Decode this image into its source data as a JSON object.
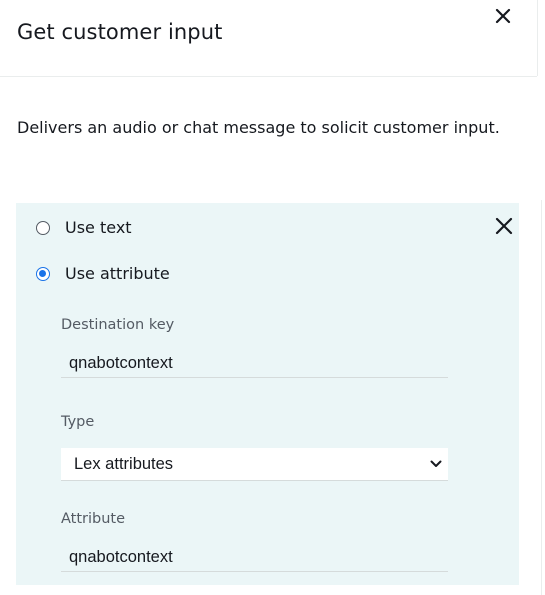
{
  "header": {
    "title": "Get customer input"
  },
  "description": "Delivers an audio or chat message to solicit customer input.",
  "options": {
    "use_text": "Use text",
    "use_attribute": "Use attribute",
    "selected": "use_attribute"
  },
  "fields": {
    "destination_key": {
      "label": "Destination key",
      "value": "qnabotcontext"
    },
    "type": {
      "label": "Type",
      "value": "Lex attributes"
    },
    "attribute": {
      "label": "Attribute",
      "value": "qnabotcontext"
    }
  },
  "icons": {
    "close": "close-icon",
    "chevron": "chevron-down-icon"
  },
  "colors": {
    "panel_bg": "#ebf6f7",
    "radio_selected": "#1a73e8"
  }
}
